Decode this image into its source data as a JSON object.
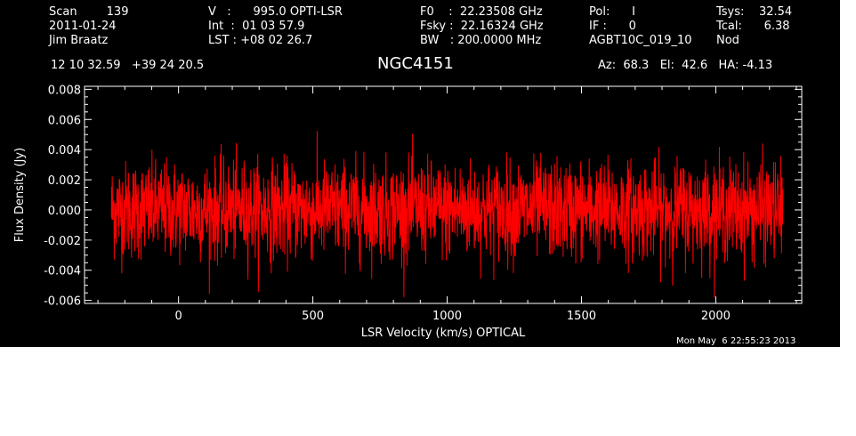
{
  "header": {
    "col1": [
      "Scan        139",
      "2011-01-24",
      "Jim Braatz"
    ],
    "col2": [
      "V   :      995.0 OPTI-LSR",
      "Int  :  01 03 57.9",
      "LST : +08 02 26.7"
    ],
    "col3": [
      "F0    :  22.23508 GHz",
      "Fsky :  22.16324 GHz",
      "BW   : 200.0000 MHz"
    ],
    "col4": [
      "Pol:      I",
      "IF :      0",
      "AGBT10C_019_10"
    ],
    "col5": [
      "Tsys:    32.54",
      "Tcal:      6.38",
      "Nod"
    ],
    "coords": "12 10 32.59   +39 24 20.5",
    "azel": "Az:  68.3   El:  42.6   HA: -4.13"
  },
  "timestamp": "Mon May  6 22:55:23 2013",
  "colors": {
    "background": "#000000",
    "foreground": "#ffffff",
    "series": "#ff0000"
  },
  "chart_data": {
    "type": "line",
    "title": "NGC4151",
    "xlabel": "LSR Velocity (km/s) OPTICAL",
    "ylabel": "Flux Density (Jy)",
    "xlim": [
      -350,
      2320
    ],
    "ylim": [
      -0.0062,
      0.0082
    ],
    "xticks": [
      0,
      500,
      1000,
      1500,
      2000
    ],
    "yticks": [
      0.008,
      0.006,
      0.004,
      0.002,
      0.0,
      -0.002,
      -0.004,
      -0.006
    ],
    "xtick_labels": [
      "0",
      "500",
      "1000",
      "1500",
      "2000"
    ],
    "ytick_labels": [
      "0.008",
      "0.006",
      "0.004",
      "0.002",
      "0.000",
      "-0.002",
      "-0.004",
      "-0.006"
    ],
    "series": [
      {
        "color": "#ff0000",
        "x_range": [
          -250,
          2250
        ],
        "mean": 0.0,
        "rms": 0.0016,
        "approx_min": -0.0058,
        "approx_max": 0.0062
      }
    ]
  }
}
